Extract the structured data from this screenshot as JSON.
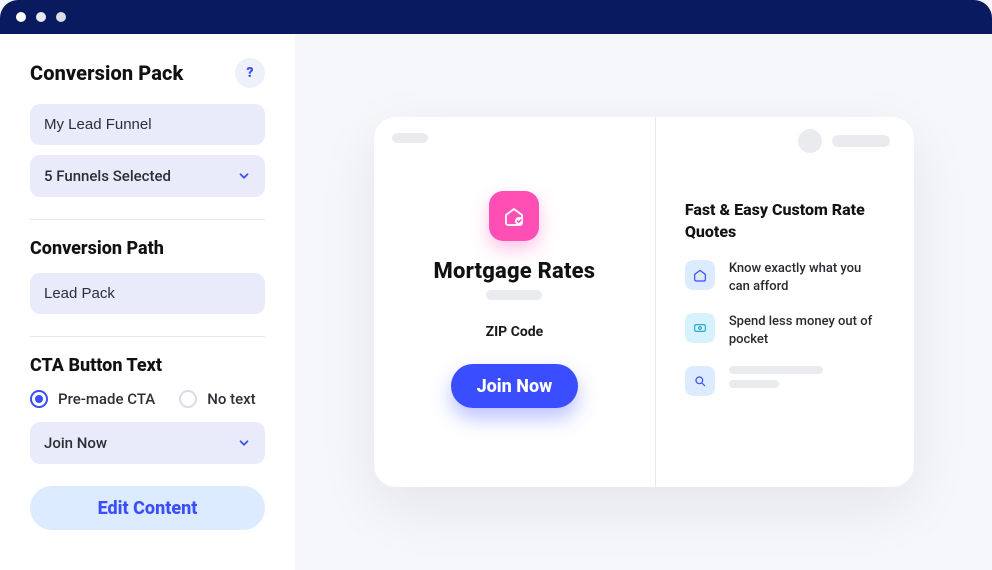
{
  "titlebar": {
    "dot_color": "#ffffff"
  },
  "sidebar": {
    "help_label": "?",
    "pack": {
      "title": "Conversion Pack",
      "name_value": "My Lead Funnel",
      "funnels_selected_label": "5 Funnels Selected"
    },
    "path": {
      "title": "Conversion Path",
      "value": "Lead Pack"
    },
    "cta": {
      "title": "CTA Button Text",
      "option_premade": "Pre-made CTA",
      "option_notext": "No text",
      "selected_label": "Join Now",
      "edit_content_label": "Edit Content"
    }
  },
  "preview": {
    "left": {
      "pink_icon": "home-check-icon",
      "title": "Mortgage Rates",
      "sub_label": "ZIP Code",
      "cta_label": "Join Now"
    },
    "right": {
      "heading": "Fast & Easy Custom Rate Quotes",
      "benefits": [
        {
          "icon": "house-icon",
          "text": "Know exactly what you can afford"
        },
        {
          "icon": "money-icon",
          "text": "Spend less money out of pocket"
        },
        {
          "icon": "search-icon",
          "text": ""
        }
      ]
    }
  },
  "colors": {
    "accent": "#3a4dff",
    "pink": "#ff4fb4"
  }
}
